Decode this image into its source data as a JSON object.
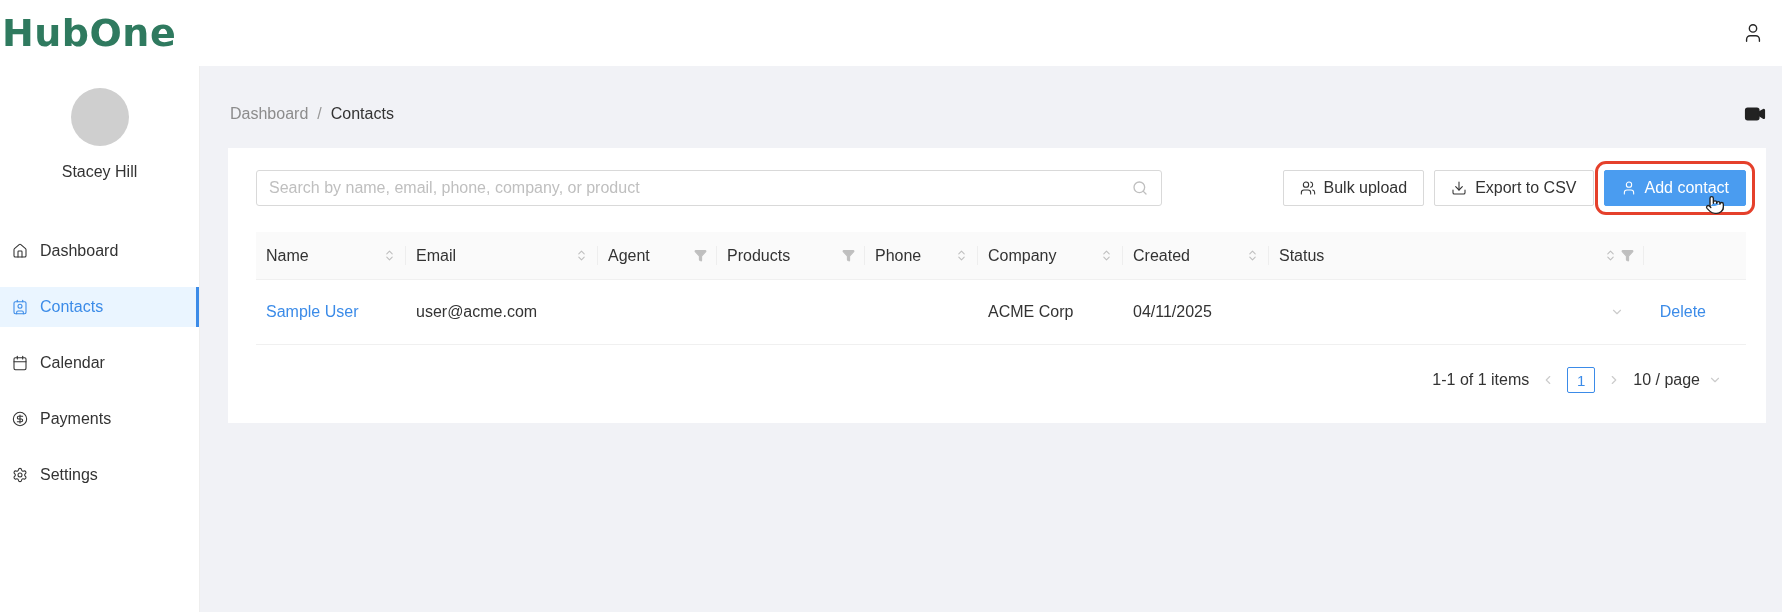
{
  "logo": "HubOne",
  "user": {
    "name": "Stacey Hill"
  },
  "nav": [
    {
      "label": "Dashboard",
      "selected": false
    },
    {
      "label": "Contacts",
      "selected": true
    },
    {
      "label": "Calendar",
      "selected": false
    },
    {
      "label": "Payments",
      "selected": false
    },
    {
      "label": "Settings",
      "selected": false
    }
  ],
  "breadcrumb": [
    "Dashboard",
    "Contacts"
  ],
  "breadcrumb_separator": "/",
  "search": {
    "placeholder": "Search by name, email, phone, company, or product"
  },
  "actions": [
    {
      "label": "Bulk upload",
      "kind": "default",
      "highlighted": false
    },
    {
      "label": "Export to CSV",
      "kind": "default",
      "highlighted": false
    },
    {
      "label": "Add contact",
      "kind": "primary",
      "highlighted": true
    }
  ],
  "table": {
    "columns": [
      {
        "label": "Name",
        "sort": true,
        "filter": false
      },
      {
        "label": "Email",
        "sort": true,
        "filter": false
      },
      {
        "label": "Agent",
        "sort": false,
        "filter": true
      },
      {
        "label": "Products",
        "sort": false,
        "filter": true
      },
      {
        "label": "Phone",
        "sort": true,
        "filter": false
      },
      {
        "label": "Company",
        "sort": true,
        "filter": false
      },
      {
        "label": "Created",
        "sort": true,
        "filter": false
      },
      {
        "label": "Status",
        "sort": true,
        "filter": true
      }
    ],
    "rows": [
      {
        "name": "Sample User",
        "email": "user@acme.com",
        "company": "ACME Corp",
        "created": "04/11/2025",
        "action": "Delete"
      }
    ]
  },
  "pagination": {
    "summary": "1-1 of 1 items",
    "pages": [
      {
        "label": "1",
        "selected": true
      }
    ],
    "page_size": "10 / page"
  }
}
